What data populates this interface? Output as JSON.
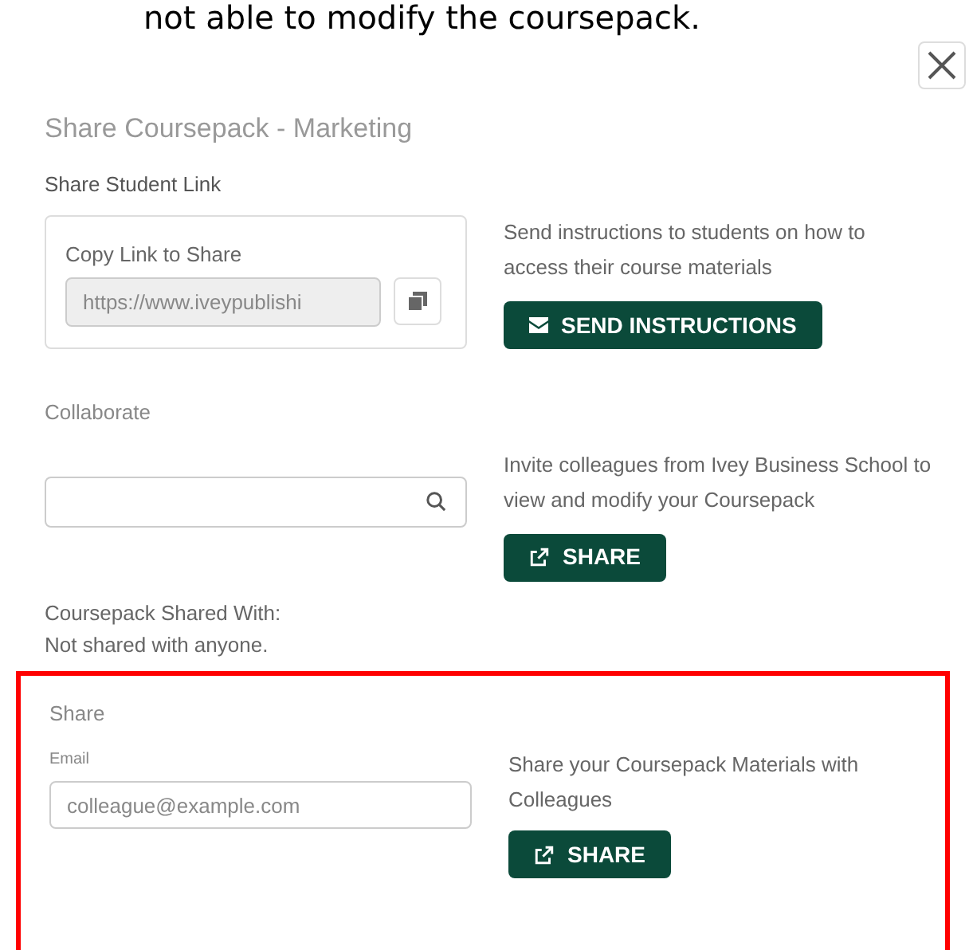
{
  "top_text": "not able to modify the coursepack.",
  "dialog": {
    "title": "Share Coursepack - Marketing"
  },
  "student_link": {
    "heading": "Share Student Link",
    "label": "Copy Link to Share",
    "link_value": "https://www.iveypublishi",
    "description": "Send instructions to students on how to access their course materials",
    "button": "SEND INSTRUCTIONS"
  },
  "collaborate": {
    "heading": "Collaborate",
    "description": "Invite colleagues from Ivey Business School to view and modify your Coursepack",
    "button": "SHARE"
  },
  "shared_with": {
    "label": "Coursepack Shared With:",
    "value": "Not shared with anyone."
  },
  "share": {
    "heading": "Share",
    "highlighted": true,
    "email_label": "Email",
    "email_placeholder": "colleague@example.com",
    "description": "Share your Coursepack Materials with Colleagues",
    "button": "SHARE"
  }
}
